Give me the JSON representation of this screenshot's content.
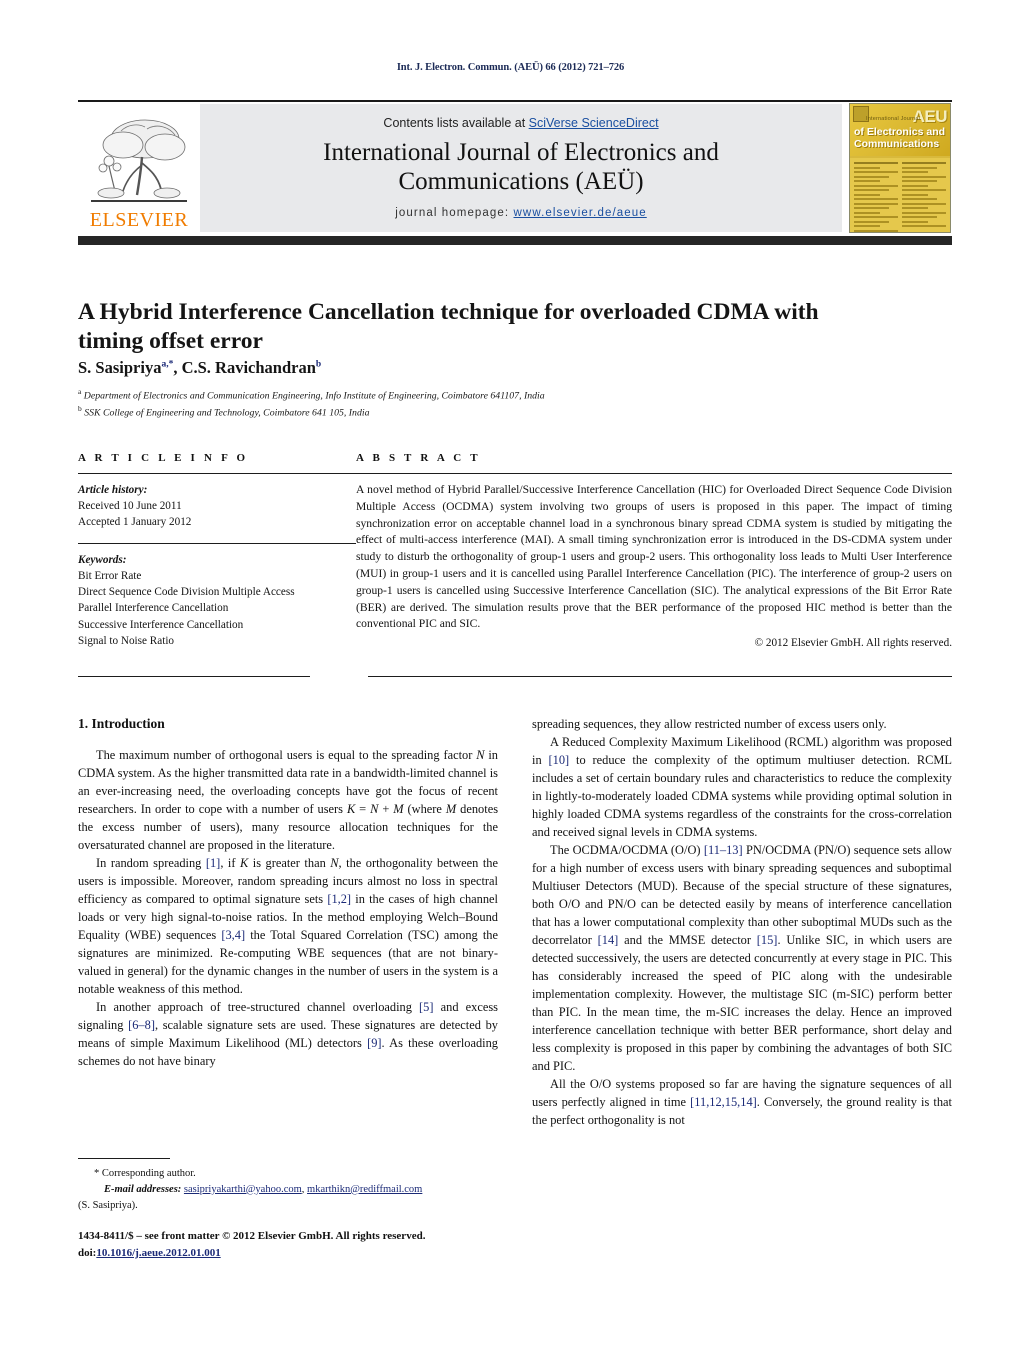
{
  "running_head": "Int. J. Electron. Commun. (AEÜ) 66 (2012) 721–726",
  "header": {
    "contents_prefix": "Contents lists available at ",
    "sciencedirect_link": "SciVerse ScienceDirect",
    "journal_title_line1": "International Journal of Electronics and",
    "journal_title_line2": "Communications (AEÜ)",
    "homepage_label": "journal homepage: ",
    "homepage_url": "www.elsevier.de/aeue",
    "publisher_name": "ELSEVIER",
    "cover": {
      "aeu_badge": "AEU",
      "small_line": "International Journal",
      "title_line1": "of Electronics and",
      "title_line2": "Communications"
    }
  },
  "article": {
    "title": "A Hybrid Interference Cancellation technique for overloaded CDMA with timing offset error",
    "authors_html": "S. Sasipriya<sup>a,*</sup>, C.S. Ravichandran<sup>b</sup>",
    "affiliation_a": "Department of Electronics and Communication Engineering, Info Institute of Engineering, Coimbatore 641107, India",
    "affiliation_b": "SSK College of Engineering and Technology, Coimbatore 641 105, India"
  },
  "article_info": {
    "heading": "A R T I C L E   I N F O",
    "history_label": "Article history:",
    "received": "Received 10 June 2011",
    "accepted": "Accepted 1 January 2012",
    "keywords_label": "Keywords:",
    "keywords": [
      "Bit Error Rate",
      "Direct Sequence Code Division Multiple Access",
      "Parallel Interference Cancellation",
      "Successive Interference Cancellation",
      "Signal to Noise Ratio"
    ]
  },
  "abstract": {
    "heading": "A B S T R A C T",
    "text": "A novel method of Hybrid Parallel/Successive Interference Cancellation (HIC) for Overloaded Direct Sequence Code Division Multiple Access (OCDMA) system involving two groups of users is proposed in this paper. The impact of timing synchronization error on acceptable channel load in a synchronous binary spread CDMA system is studied by mitigating the effect of multi-access interference (MAI). A small timing synchronization error is introduced in the DS-CDMA system under study to disturb the orthogonality of group-1 users and group-2 users. This orthogonality loss leads to Multi User Interference (MUI) in group-1 users and it is cancelled using Parallel Interference Cancellation (PIC). The interference of group-2 users on group-1 users is cancelled using Successive Interference Cancellation (SIC). The analytical expressions of the Bit Error Rate (BER) are derived. The simulation results prove that the BER performance of the proposed HIC method is better than the conventional PIC and SIC.",
    "copyright": "© 2012 Elsevier GmbH. All rights reserved."
  },
  "introduction": {
    "heading": "1.  Introduction",
    "left_paragraphs": [
      "The maximum number of orthogonal users is equal to the spreading factor <i>N</i> in CDMA system. As the higher transmitted data rate in a bandwidth-limited channel is an ever-increasing need, the overloading concepts have got the focus of recent researchers. In order to cope with a number of users <i>K</i> = <i>N</i> + <i>M</i> (where <i>M</i> denotes the excess number of users), many resource allocation techniques for the oversaturated channel are proposed in the literature.",
      "In random spreading <span class=\"ref\">[1]</span>, if <i>K</i> is greater than <i>N</i>, the orthogonality between the users is impossible. Moreover, random spreading incurs almost no loss in spectral efficiency as compared to optimal signature sets <span class=\"ref\">[1,2]</span> in the cases of high channel loads or very high signal-to-noise ratios. In the method employing Welch–Bound Equality (WBE) sequences <span class=\"ref\">[3,4]</span> the Total Squared Correlation (TSC) among the signatures are minimized. Re-computing WBE sequences (that are not binary-valued in general) for the dynamic changes in the number of users in the system is a notable weakness of this method.",
      "In another approach of tree-structured channel overloading <span class=\"ref\">[5]</span> and excess signaling <span class=\"ref\">[6–8]</span>, scalable signature sets are used. These signatures are detected by means of simple Maximum Likelihood (ML) detectors <span class=\"ref\">[9]</span>. As these overloading schemes do not have binary"
    ],
    "right_paragraphs": [
      "spreading sequences, they allow restricted number of excess users only.",
      "A Reduced Complexity Maximum Likelihood (RCML) algorithm was proposed in <span class=\"ref\">[10]</span> to reduce the complexity of the optimum multiuser detection. RCML includes a set of certain boundary rules and characteristics to reduce the complexity in lightly-to-moderately loaded CDMA systems while providing optimal solution in highly loaded CDMA systems regardless of the constraints for the cross-correlation and received signal levels in CDMA systems.",
      "The OCDMA/OCDMA (O/O) <span class=\"ref\">[11–13]</span> PN/OCDMA (PN/O) sequence sets allow for a high number of excess users with binary spreading sequences and suboptimal Multiuser Detectors (MUD). Because of the special structure of these signatures, both O/O and PN/O can be detected easily by means of interference cancellation that has a lower computational complexity than other suboptimal MUDs such as the decorrelator <span class=\"ref\">[14]</span> and the MMSE detector <span class=\"ref\">[15]</span>. Unlike SIC, in which users are detected successively, the users are detected concurrently at every stage in PIC. This has considerably increased the speed of PIC along with the undesirable implementation complexity. However, the multistage SIC (m-SIC) perform better than PIC. In the mean time, the m-SIC increases the delay. Hence an improved interference cancellation technique with better BER performance, short delay and less complexity is proposed in this paper by combining the advantages of both SIC and PIC.",
      "All the O/O systems proposed so far are having the signature sequences of all users perfectly aligned in time <span class=\"ref\">[11,12,15,14]</span>. Conversely, the ground reality is that the perfect orthogonality is not"
    ]
  },
  "footnote": {
    "corresponding": "* Corresponding author.",
    "email_label": "E-mail addresses:",
    "email1": "sasipriyakarthi@yahoo.com",
    "email2": "mkarthikn@rediffmail.com",
    "email_owner": "(S. Sasipriya)."
  },
  "footer": {
    "front_matter": "1434-8411/$ – see front matter © 2012 Elsevier GmbH. All rights reserved.",
    "doi_label": "doi:",
    "doi_value": "10.1016/j.aeue.2012.01.001"
  },
  "colors": {
    "link_blue": "#1a4fa0",
    "ref_blue": "#1b2a77",
    "elsevier_orange": "#f07c00",
    "band_gray": "#e8e9eb",
    "rule_dark": "#262626",
    "cover_yellow": "#d8b93c"
  }
}
